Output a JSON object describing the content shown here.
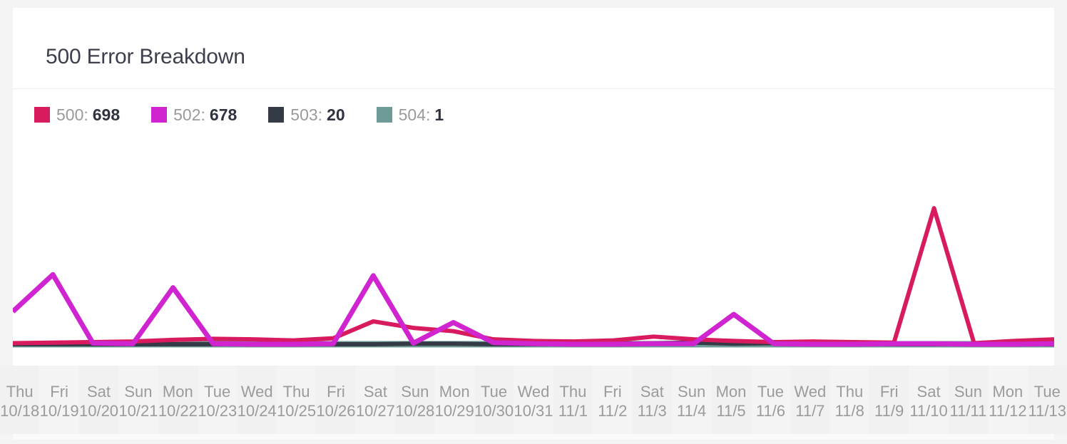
{
  "card": {
    "title": "500 Error Breakdown"
  },
  "legend": [
    {
      "name": "legend-item-500",
      "label": "500:",
      "value": "698",
      "color": "#d81b5f"
    },
    {
      "name": "legend-item-502",
      "label": "502:",
      "value": "678",
      "color": "#cf24cf"
    },
    {
      "name": "legend-item-503",
      "label": "503:",
      "value": "20",
      "color": "#343a46"
    },
    {
      "name": "legend-item-504",
      "label": "504:",
      "value": "1",
      "color": "#6f9b96"
    }
  ],
  "chart_data": {
    "type": "line",
    "title": "500 Error Breakdown",
    "xlabel": "",
    "ylabel": "",
    "grid": false,
    "legend_position": "top-left",
    "ylim": [
      0,
      300
    ],
    "categories": [
      "10/18",
      "10/19",
      "10/20",
      "10/21",
      "10/22",
      "10/23",
      "10/24",
      "10/25",
      "10/26",
      "10/27",
      "10/28",
      "10/29",
      "10/30",
      "10/31",
      "11/1",
      "11/2",
      "11/3",
      "11/4",
      "11/5",
      "11/6",
      "11/7",
      "11/8",
      "11/9",
      "11/10",
      "11/11",
      "11/12",
      "11/13"
    ],
    "x_day_labels": [
      "Thu",
      "Fri",
      "Sat",
      "Sun",
      "Mon",
      "Tue",
      "Wed",
      "Thu",
      "Fri",
      "Sat",
      "Sun",
      "Mon",
      "Tue",
      "Wed",
      "Thu",
      "Fri",
      "Sat",
      "Sun",
      "Mon",
      "Tue",
      "Wed",
      "Thu",
      "Fri",
      "Sat",
      "Sun",
      "Mon",
      "Tue"
    ],
    "series": [
      {
        "name": "500",
        "total": 698,
        "color": "#d81b5f",
        "values": [
          2,
          3,
          4,
          5,
          8,
          10,
          9,
          7,
          11,
          42,
          30,
          24,
          9,
          6,
          5,
          7,
          14,
          9,
          6,
          4,
          5,
          4,
          3,
          250,
          2,
          6,
          9
        ]
      },
      {
        "name": "502",
        "total": 678,
        "color": "#cf24cf",
        "values": [
          60,
          128,
          2,
          1,
          104,
          1,
          0,
          0,
          1,
          126,
          2,
          40,
          3,
          1,
          0,
          0,
          1,
          1,
          55,
          1,
          0,
          0,
          1,
          1,
          0,
          0,
          1
        ]
      },
      {
        "name": "503",
        "total": 20,
        "color": "#343a46",
        "values": [
          0,
          0,
          0,
          0,
          0,
          0,
          0,
          0,
          0,
          0,
          1,
          1,
          0,
          0,
          0,
          1,
          2,
          3,
          1,
          2,
          2,
          1,
          0,
          0,
          0,
          0,
          0
        ]
      },
      {
        "name": "504",
        "total": 1,
        "color": "#6f9b96",
        "values": [
          0,
          0,
          0,
          0,
          0,
          0,
          0,
          0,
          0,
          0,
          0,
          0,
          0,
          0,
          0,
          0,
          0,
          0,
          0,
          0,
          0,
          0,
          0,
          0,
          0,
          0,
          0
        ]
      }
    ]
  }
}
